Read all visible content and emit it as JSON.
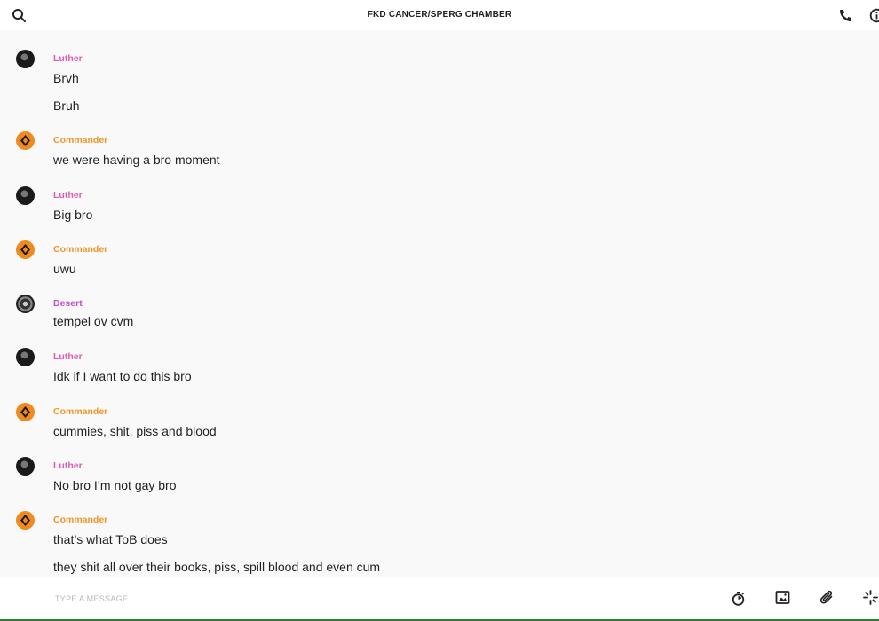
{
  "header": {
    "title": "FKD CANCER/SPERG CHAMBER",
    "left_icon": "search-icon",
    "right_icons": [
      "phone-icon",
      "info-icon"
    ]
  },
  "colors": {
    "luther": "#e05cb0",
    "commander": "#f0962a",
    "desert": "#c44fd2"
  },
  "messages": [
    {
      "sender": "Luther",
      "lines": [
        "Brvh",
        "Bruh"
      ]
    },
    {
      "sender": "Commander",
      "lines": [
        "we were having a bro moment"
      ]
    },
    {
      "sender": "Luther",
      "lines": [
        "Big bro"
      ]
    },
    {
      "sender": "Commander",
      "lines": [
        "uwu"
      ]
    },
    {
      "sender": "Desert",
      "lines": [
        "tempel ov cvm"
      ]
    },
    {
      "sender": "Luther",
      "lines": [
        "Idk if I want to do this bro"
      ]
    },
    {
      "sender": "Commander",
      "lines": [
        "cummies, shit, piss and blood"
      ]
    },
    {
      "sender": "Luther",
      "lines": [
        "No bro I’m not gay bro"
      ]
    },
    {
      "sender": "Commander",
      "lines": [
        "that’s what ToB does",
        "they shit all over their books, piss, spill blood and even cum"
      ]
    }
  ],
  "composer": {
    "placeholder": "TYPE A MESSAGE",
    "value": "",
    "icons": [
      "timer-icon",
      "image-icon",
      "paperclip-icon",
      "sticker-icon"
    ]
  }
}
